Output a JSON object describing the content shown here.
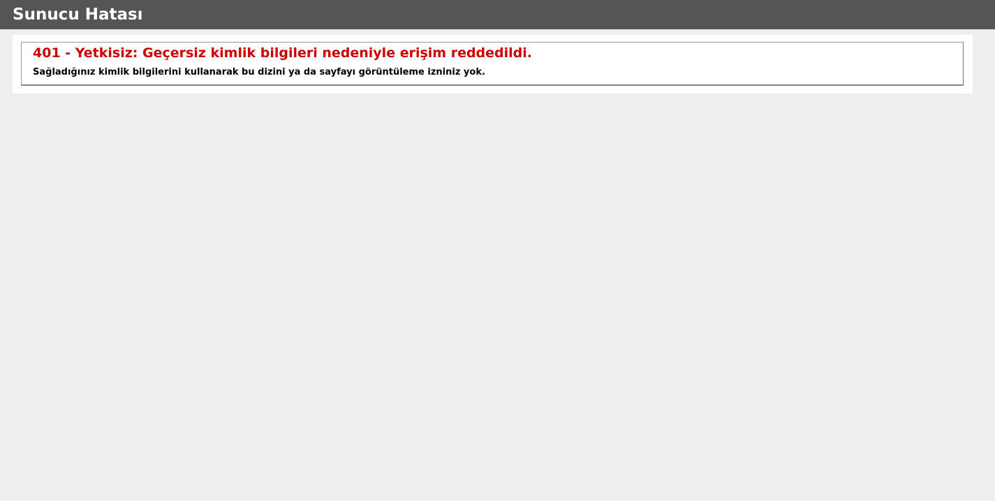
{
  "header": {
    "title": "Sunucu Hatası"
  },
  "error": {
    "heading": "401 - Yetkisiz: Geçersiz kimlik bilgileri nedeniyle erişim reddedildi.",
    "message": "Sağladığınız kimlik bilgilerini kullanarak bu dizini ya da sayfayı görüntüleme izniniz yok."
  },
  "colors": {
    "header_bg": "#555555",
    "page_bg": "#eeeeee",
    "error_heading": "#cc0000"
  }
}
